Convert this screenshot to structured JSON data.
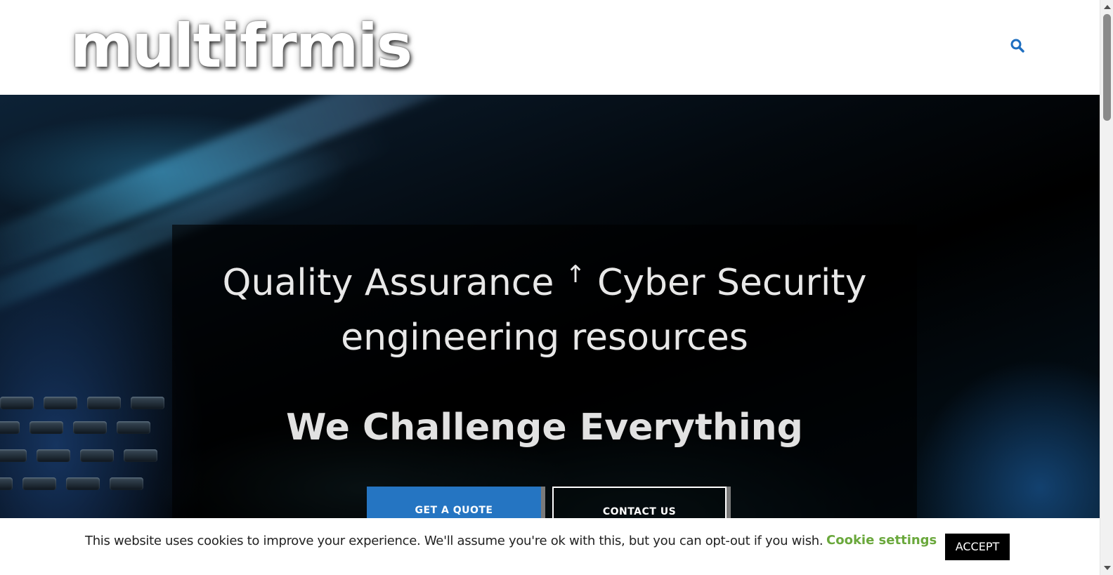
{
  "header": {
    "logo_text_left": "multif",
    "logo_text_right": "rmis",
    "search_icon": "search-icon"
  },
  "hero": {
    "heading_part1": "Quality Assurance",
    "heading_symbol": "↑",
    "heading_part2": "Cyber Security",
    "heading_line2": "engineering resources",
    "subheading": "We Challenge Everything",
    "buttons": {
      "quote": "GET A QUOTE",
      "contact": "CONTACT US"
    }
  },
  "cookie_bar": {
    "message": "This website uses cookies to improve your experience. We'll assume you're ok with this, but you can opt-out if you wish.",
    "settings_link": "Cookie settings",
    "accept": "ACCEPT"
  },
  "colors": {
    "primary_button": "#2575c2",
    "cookie_link": "#6aa83c",
    "search_icon": "#1f6fc0",
    "logo_accent": "#ef4a4f"
  }
}
